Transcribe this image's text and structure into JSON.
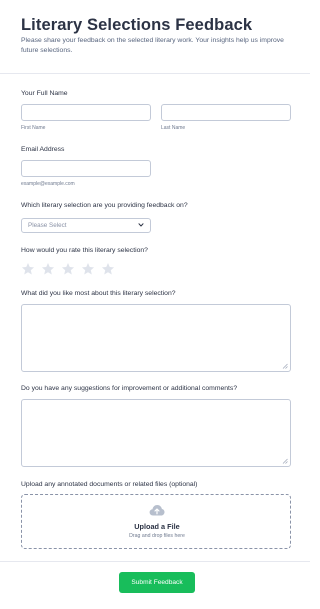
{
  "header": {
    "title": "Literary Selections Feedback",
    "subtitle": "Please share your feedback on the selected literary work. Your insights help us improve future selections."
  },
  "full_name": {
    "label": "Your Full Name",
    "first_sublabel": "First Name",
    "last_sublabel": "Last Name",
    "first_value": "",
    "last_value": ""
  },
  "email": {
    "label": "Email Address",
    "sublabel": "example@example.com",
    "value": ""
  },
  "selection": {
    "label": "Which literary selection are you providing feedback on?",
    "placeholder": "Please Select",
    "icon": "chevron-down-icon"
  },
  "rating": {
    "label": "How would you rate this literary selection?",
    "max": 5,
    "value": 0,
    "star_color": "#dfe3eb",
    "icon": "star-icon"
  },
  "liked": {
    "label": "What did you like most about this literary selection?",
    "value": ""
  },
  "suggestions": {
    "label": "Do you have any suggestions for improvement or additional comments?",
    "value": ""
  },
  "upload": {
    "label": "Upload any annotated documents or related files (optional)",
    "title": "Upload a File",
    "subtitle": "Drag and drop files here",
    "icon": "cloud-upload-icon"
  },
  "submit": {
    "label": "Submit Feedback",
    "color": "#18bd5b"
  }
}
